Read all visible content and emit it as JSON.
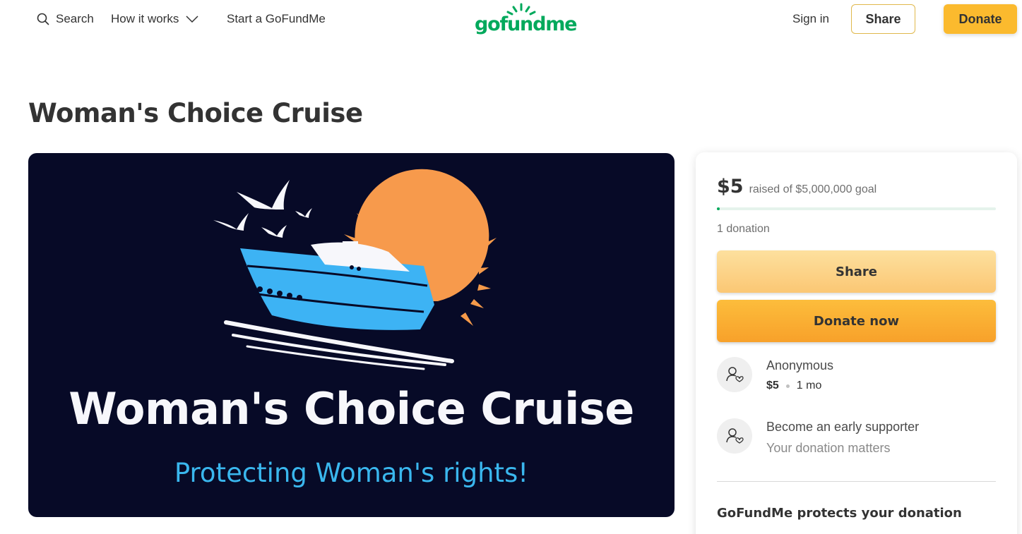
{
  "header": {
    "search_label": "Search",
    "how_it_works_label": "How it works",
    "start_label": "Start a GoFundMe",
    "logo_text": "gofundme",
    "sign_in_label": "Sign in",
    "share_label": "Share",
    "donate_label": "Donate"
  },
  "campaign": {
    "title": "Woman's Choice Cruise",
    "image": {
      "headline": "Woman's Choice Cruise",
      "tagline": "Protecting Woman's rights!"
    }
  },
  "card": {
    "raised_amount": "$5",
    "raised_text": "raised of $5,000,000 goal",
    "progress_fraction": 1e-06,
    "donation_count": "1 donation",
    "share_label": "Share",
    "donate_label": "Donate now",
    "donors": [
      {
        "name": "Anonymous",
        "amount": "$5",
        "time": "1 mo"
      }
    ],
    "early_supporter": {
      "title": "Become an early supporter",
      "subtitle": "Your donation matters"
    },
    "protect_text": "GoFundMe protects your donation"
  },
  "colors": {
    "brand_green": "#02a95c",
    "donate_yellow": "#fbba2e",
    "hero_background": "#070a27"
  }
}
